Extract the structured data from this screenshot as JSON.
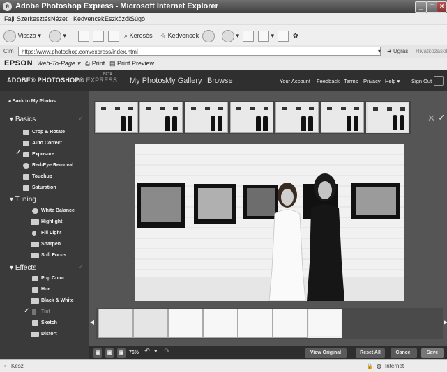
{
  "window": {
    "title": "Adobe Photoshop Express - Microsoft Internet Explorer"
  },
  "menu": [
    "Fájl",
    "Szerkesztés",
    "Nézet",
    "Kedvencek",
    "Eszközök",
    "Súgó"
  ],
  "toolbar": {
    "back": "Vissza",
    "search": "Keresés",
    "favorites": "Kedvencek"
  },
  "address": {
    "label": "Cím",
    "url": "https://www.photoshop.com/express/index.html",
    "go": "Ugrás",
    "links": "Hivatkozások"
  },
  "linksbar": {
    "brand": "EPSON",
    "web_to_page": "Web-To-Page",
    "print": "Print",
    "print_preview": "Print Preview"
  },
  "app": {
    "logo": "ADOBE® PHOTOSHOP®",
    "logo_suffix": "EXPRESS",
    "beta": "BETA",
    "nav": [
      "My Photos",
      "My Gallery",
      "Browse"
    ],
    "right_nav": [
      "Your Account",
      "Feedback",
      "Terms",
      "Privacy",
      "Help ▾",
      "Sign Out"
    ]
  },
  "sidebar": {
    "back": "◂ Back to My Photos",
    "sections": [
      {
        "title": "Basics",
        "items": [
          "Crop & Rotate",
          "Auto Correct",
          "Exposure",
          "Red-Eye Removal",
          "Touchup",
          "Saturation"
        ]
      },
      {
        "title": "Tuning",
        "items": [
          "White Balance",
          "Highlight",
          "Fill Light",
          "Sharpen",
          "Soft Focus"
        ]
      },
      {
        "title": "Effects",
        "items": [
          "Pop Color",
          "Hue",
          "Black & White",
          "Tint",
          "Sketch",
          "Distort"
        ]
      }
    ]
  },
  "bottom": {
    "zoom": "76%",
    "view_original": "View Original",
    "reset_all": "Reset All",
    "cancel": "Cancel",
    "save": "Save"
  },
  "status": {
    "left": "Kész",
    "right": "Internet"
  }
}
